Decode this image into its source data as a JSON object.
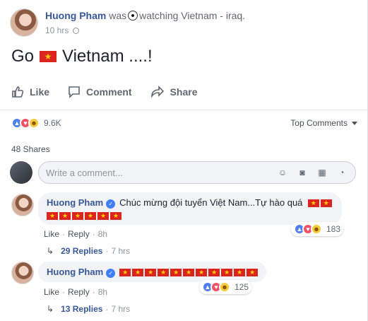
{
  "post": {
    "author": "Huong Pham",
    "activity_prefix": "was",
    "activity": "watching Vietnam - iraq.",
    "time": "10 hrs",
    "text_before": "Go",
    "text_after": "Vietnam ....!",
    "actions": {
      "like": "Like",
      "comment": "Comment",
      "share": "Share"
    },
    "reaction_count": "9.6K",
    "sort_label": "Top Comments",
    "shares": "48 Shares",
    "composer_placeholder": "Write a comment..."
  },
  "comments": [
    {
      "author": "Huong Pham",
      "text": "Chúc mừng đội tuyển Việt Nam...Tự hào quá",
      "flags_inline": 2,
      "flags_line2": 6,
      "like": "Like",
      "reply": "Reply",
      "time": "8h",
      "reaction_count": "183",
      "replies": "29 Replies",
      "replies_time": "7 hrs"
    },
    {
      "author": "Huong Pham",
      "flags_inline": 11,
      "like": "Like",
      "reply": "Reply",
      "time": "8h",
      "reaction_count": "125",
      "replies": "13 Replies",
      "replies_time": "7 hrs"
    }
  ],
  "colors": {
    "link": "#385898",
    "muted": "#90949c",
    "flag_red": "#da251d",
    "flag_star": "#ffcd00"
  }
}
